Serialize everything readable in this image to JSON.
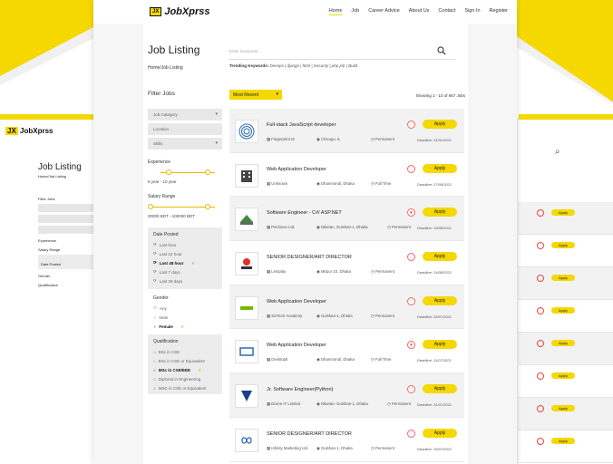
{
  "brand": {
    "badge": "JX",
    "name": "JobXprss"
  },
  "nav": [
    "Home",
    "Job",
    "Career Advice",
    "About Us",
    "Contact",
    "Sign In",
    "Register"
  ],
  "page": {
    "title": "Job Listing",
    "breadcrumb": "Home/Job Listing",
    "search_placeholder": "Enter keywords...",
    "trending_label": "Trending Keywords:",
    "trending_items": "Devops | django | html | Security | php job | Build",
    "sort_value": "Most Recent",
    "showing": "Showing 1 - 10 of 667 Jobs"
  },
  "filters": {
    "title": "Filter Jobs",
    "category": "Job Category",
    "location": "Location",
    "skills": "Skills",
    "experience_title": "Experience",
    "experience_value": "5 year - 10 year",
    "salary_title": "Salary Range",
    "salary_value": "30000 BDT - 100000 BDT",
    "date_title": "Date Posted",
    "date_options": [
      "Last hour",
      "Last 24 hour",
      "Last 48 hour",
      "Last 7 days",
      "Last 28 days"
    ],
    "gender_title": "Gender",
    "gender_options": [
      "Any",
      "Male",
      "Female"
    ],
    "qualification_title": "Qualification",
    "qualification_options": [
      "BSc in CSE",
      "BSc in CSE or Equivalent",
      "MSc in CSE/EEE",
      "Diploma in Engineering",
      "MSC in CSE or Equivalent"
    ]
  },
  "jobs": [
    {
      "title": "Full-stack JavaScript developer",
      "company": "Fingerprint.IS",
      "location": "Chicago, IL",
      "type": "Permanent",
      "deadline": "Deadline: 31/01/2021",
      "logo": "fingerprint"
    },
    {
      "title": "Web Application Developer",
      "company": "Unknown",
      "location": "Dhanmondi, Dhaka",
      "type": "Full Time",
      "deadline": "Deadline: 27/09/2021",
      "logo": "building"
    },
    {
      "title": "Software Engineer - C#/ ASP.NET",
      "company": "Pachisun Ltd.",
      "location": "Niketan, Gulshan-1, Dhaka",
      "type": "Permanent",
      "deadline": "Deadline: 19/08/2021",
      "logo": "pachisun"
    },
    {
      "title": "SENIOR DESIGNER/ART DIRECTOR",
      "company": "Letsplay",
      "location": "Mirpur 10, Dhaka",
      "type": "Permanent",
      "deadline": "Deadline: 24/08/2021",
      "logo": "letsplay"
    },
    {
      "title": "Web Application Developer",
      "company": "SciTech Academy",
      "location": "Gulshan-1, Dhaka",
      "type": "Permanent",
      "deadline": "Deadline: 05/07/2021",
      "logo": "scitech"
    },
    {
      "title": "Web Application Developer",
      "company": "DesktopIt",
      "location": "Dhanmondi, Dhaka",
      "type": "Full Time",
      "deadline": "Deadline: 11/07/2021",
      "logo": "desktopit"
    },
    {
      "title": "Jr. Software Engineer(Python)",
      "company": "Divine IT Limited",
      "location": "Niketan- Gulshan-1, Dhaka",
      "type": "Permanent",
      "deadline": "Deadline: 31/07/2021",
      "logo": "divine"
    },
    {
      "title": "SENIOR DESIGNER/ART DIRECTOR",
      "company": "Infinity Marketing Ltd.",
      "location": "Gulshan-1, Dhaka",
      "type": "Permanent",
      "deadline": "Deadline: 29/07/2021",
      "logo": "infinity"
    }
  ],
  "apply_label": "Apply"
}
